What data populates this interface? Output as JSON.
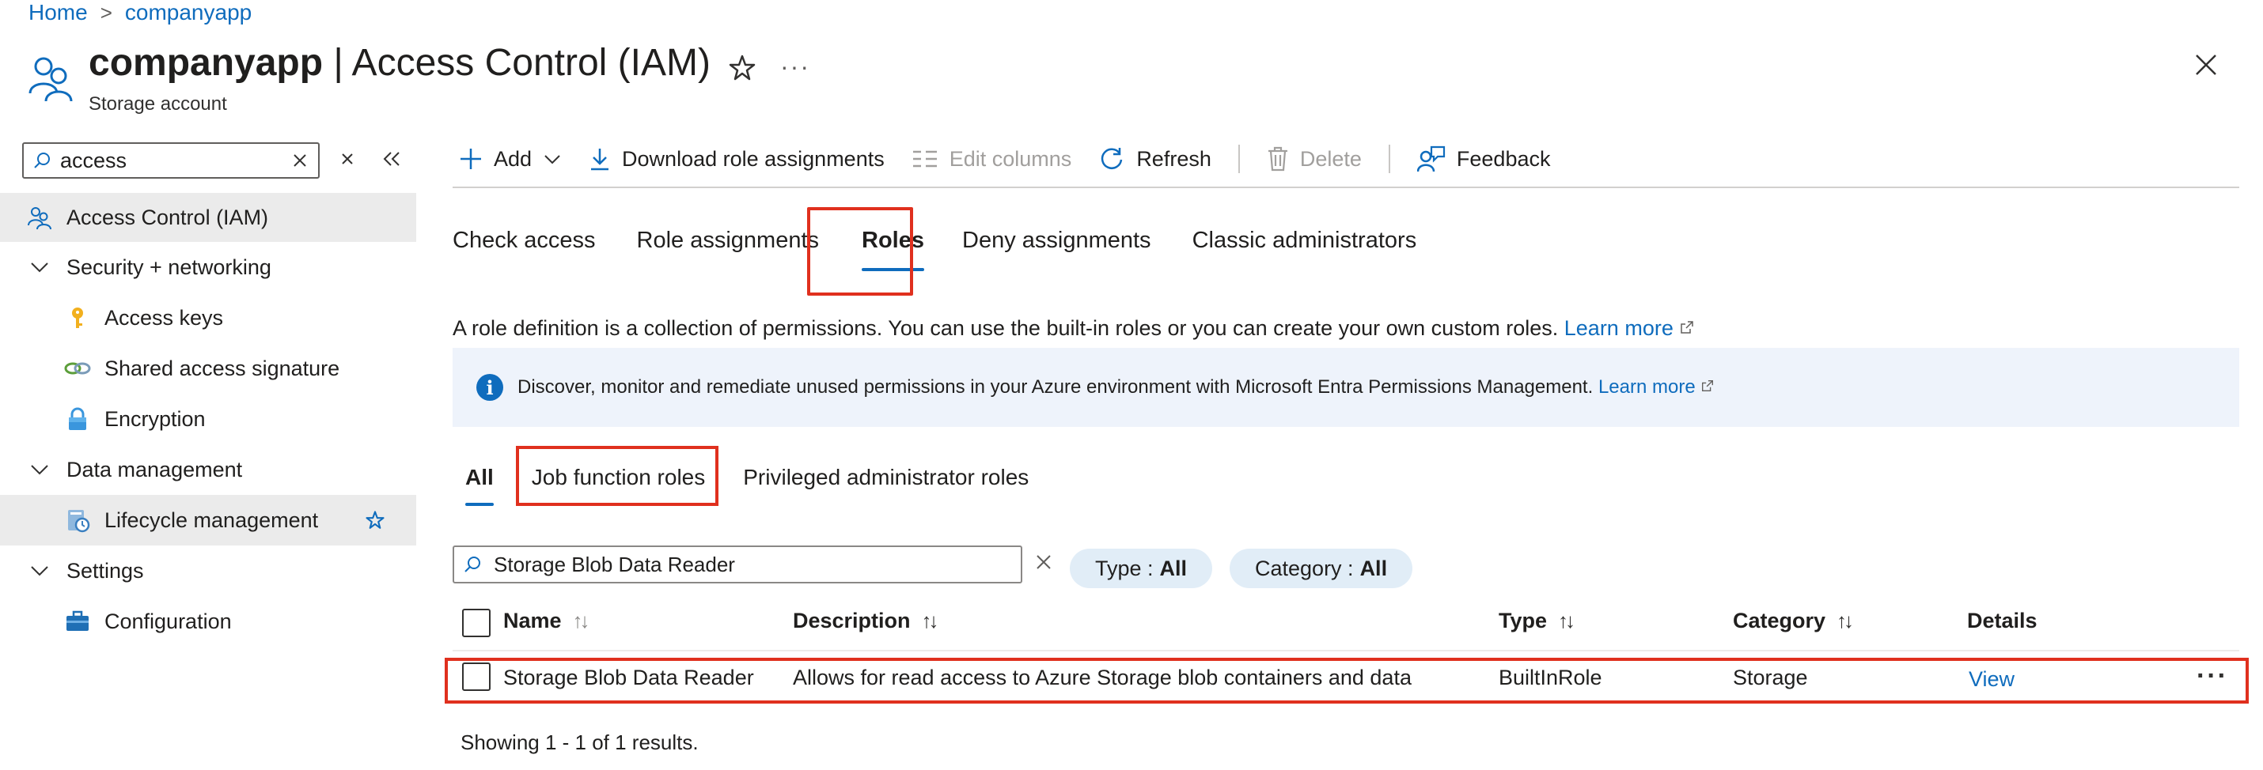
{
  "breadcrumb": {
    "home": "Home",
    "current": "companyapp"
  },
  "header": {
    "title_bold": "companyapp",
    "title_rest": " | Access Control (IAM)",
    "subtitle": "Storage account",
    "more": "···"
  },
  "sidebar": {
    "search_value": "access",
    "items": [
      {
        "label": "Access Control (IAM)",
        "icon": "people-icon"
      },
      {
        "label": "Security + networking",
        "icon": "chevron-down-icon"
      },
      {
        "label": "Access keys",
        "icon": "key-icon"
      },
      {
        "label": "Shared access signature",
        "icon": "link-icon"
      },
      {
        "label": "Encryption",
        "icon": "lock-icon"
      },
      {
        "label": "Data management",
        "icon": "chevron-down-icon"
      },
      {
        "label": "Lifecycle management",
        "icon": "lifecycle-icon"
      },
      {
        "label": "Settings",
        "icon": "chevron-down-icon"
      },
      {
        "label": "Configuration",
        "icon": "toolbox-icon"
      }
    ]
  },
  "toolbar": {
    "add": "Add",
    "download": "Download role assignments",
    "edit_columns": "Edit columns",
    "refresh": "Refresh",
    "delete": "Delete",
    "feedback": "Feedback"
  },
  "tabs": [
    "Check access",
    "Role assignments",
    "Roles",
    "Deny assignments",
    "Classic administrators"
  ],
  "active_tab": "Roles",
  "description": {
    "text": "A role definition is a collection of permissions. You can use the built-in roles or you can create your own custom roles.",
    "link": "Learn more"
  },
  "banner": {
    "text": "Discover, monitor and remediate unused permissions in your Azure environment with Microsoft Entra Permissions Management.",
    "link": "Learn more",
    "icon": "info-icon"
  },
  "pivots": [
    "All",
    "Job function roles",
    "Privileged administrator roles"
  ],
  "filter": {
    "search_value": "Storage Blob Data Reader",
    "type_label": "Type :",
    "type_value": "All",
    "category_label": "Category :",
    "category_value": "All"
  },
  "table": {
    "columns": {
      "name": "Name",
      "description": "Description",
      "type": "Type",
      "category": "Category",
      "details": "Details"
    },
    "sort_glyph": "↑↓",
    "rows": [
      {
        "name": "Storage Blob Data Reader",
        "description": "Allows for read access to Azure Storage blob containers and data",
        "type": "BuiltInRole",
        "category": "Storage",
        "details": "View",
        "more": "···"
      }
    ]
  },
  "results": "Showing 1 - 1 of 1 results.",
  "colors": {
    "accent": "#0f6cbd",
    "highlight": "#e0301e",
    "banner_bg": "#eef3fb",
    "pill_bg": "#e1edf7"
  }
}
